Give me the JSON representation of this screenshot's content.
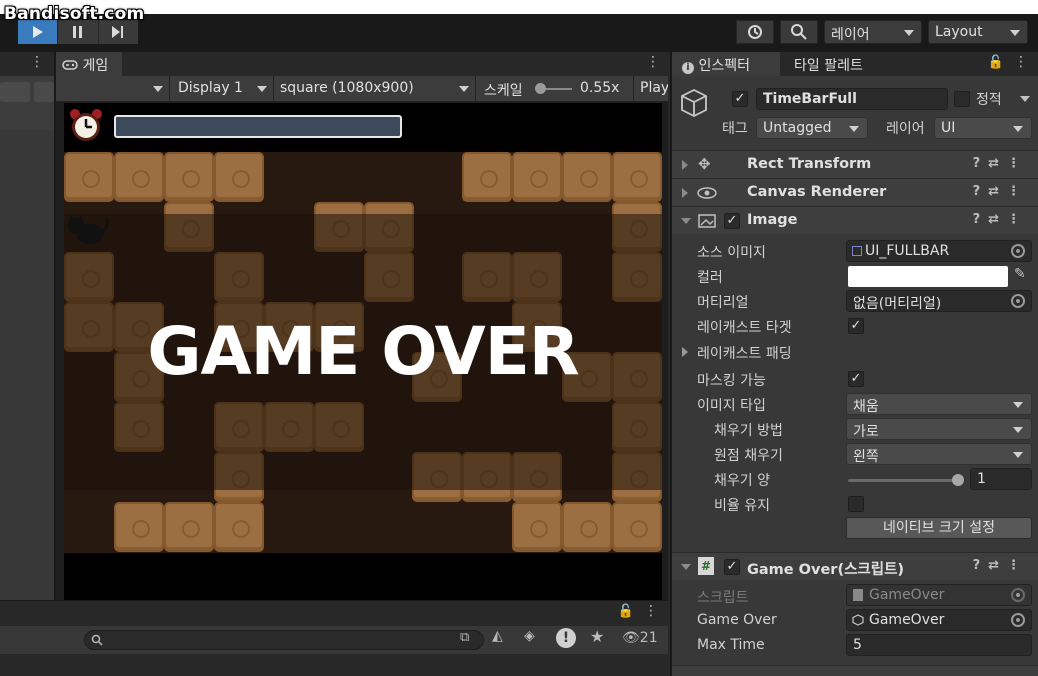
{
  "watermark": "Bandisoft.com",
  "toolbar": {
    "layer_label": "레이어",
    "layout_label": "Layout"
  },
  "game_panel": {
    "tab_label": "게임",
    "display": "Display 1",
    "resolution": "square (1080x900)",
    "scale_label": "스케일",
    "scale_value": "0.55x",
    "play_label": "Play",
    "game_over_text": "GAME OVER"
  },
  "bottom_panel": {
    "search_placeholder": "",
    "visible_count": "21"
  },
  "inspector": {
    "tab_inspector": "인스펙터",
    "tab_tile_palette": "타일 팔레트",
    "object_name": "TimeBarFull",
    "static_label": "정적",
    "tag_label": "태그",
    "tag_value": "Untagged",
    "layer_label": "레이어",
    "layer_value": "UI",
    "components": {
      "rect_transform": "Rect Transform",
      "canvas_renderer": "Canvas Renderer",
      "image": "Image",
      "game_over_script": "Game Over(스크립트)"
    },
    "image_props": {
      "source_image_label": "소스 이미지",
      "source_image_value": "UI_FULLBAR",
      "color_label": "컬러",
      "material_label": "머티리얼",
      "material_value": "없음(머티리얼)",
      "raycast_target_label": "레이캐스트 타겟",
      "raycast_padding_label": "레이캐스트 패딩",
      "maskable_label": "마스킹 가능",
      "image_type_label": "이미지 타입",
      "image_type_value": "채움",
      "fill_method_label": "채우기 방법",
      "fill_method_value": "가로",
      "fill_origin_label": "원점 채우기",
      "fill_origin_value": "왼쪽",
      "fill_amount_label": "채우기 양",
      "fill_amount_value": "1",
      "preserve_aspect_label": "비율 유지",
      "native_size_button": "네이티브 크기 설정"
    },
    "script_props": {
      "script_label": "스크립트",
      "script_value": "GameOver",
      "game_over_label": "Game Over",
      "game_over_value": "GameOver",
      "max_time_label": "Max Time",
      "max_time_value": "5"
    }
  },
  "colors": {
    "play_accent": "#3a7bbd",
    "block": "#e6a463",
    "maze_bg": "#3a2418"
  }
}
